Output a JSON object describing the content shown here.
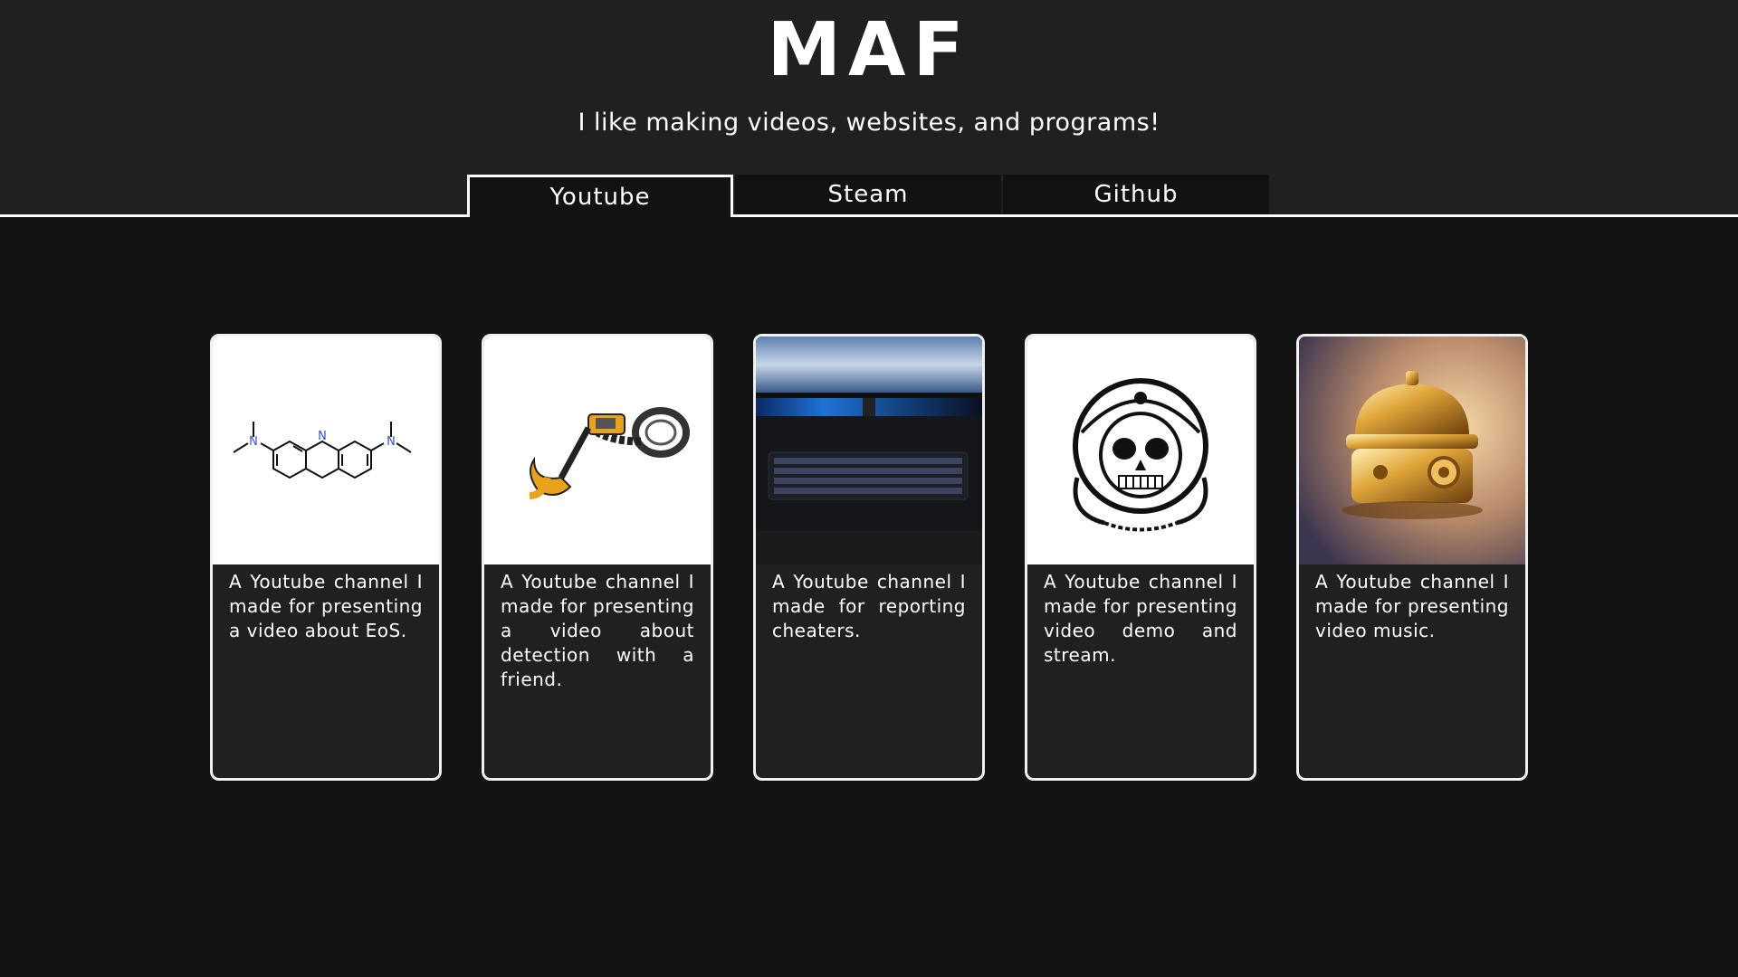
{
  "header": {
    "title": "MAF",
    "tagline": "I like making videos, websites, and programs!"
  },
  "tabs": [
    {
      "label": "Youtube",
      "active": true
    },
    {
      "label": "Steam",
      "active": false
    },
    {
      "label": "Github",
      "active": false
    }
  ],
  "cards": [
    {
      "description": "A Youtube channel I made for presenting a video about EoS.",
      "image": "chemical-structure"
    },
    {
      "description": "A Youtube channel I made for presenting a video about detection with a friend.",
      "image": "metal-detector"
    },
    {
      "description": "A Youtube channel I made for reporting cheaters.",
      "image": "keyboard-setup"
    },
    {
      "description": "A Youtube channel I made for presenting video demo and stream.",
      "image": "astronaut-skull"
    },
    {
      "description": "A Youtube channel I made for presenting video music.",
      "image": "golden-music-box"
    }
  ],
  "colors": {
    "page_background": "#121212",
    "header_background": "#202020",
    "card_background": "#202020",
    "accent": "#ffffff",
    "molecule_nitrogen": "#3b4fd8",
    "detector_yellow": "#e8a21c"
  }
}
